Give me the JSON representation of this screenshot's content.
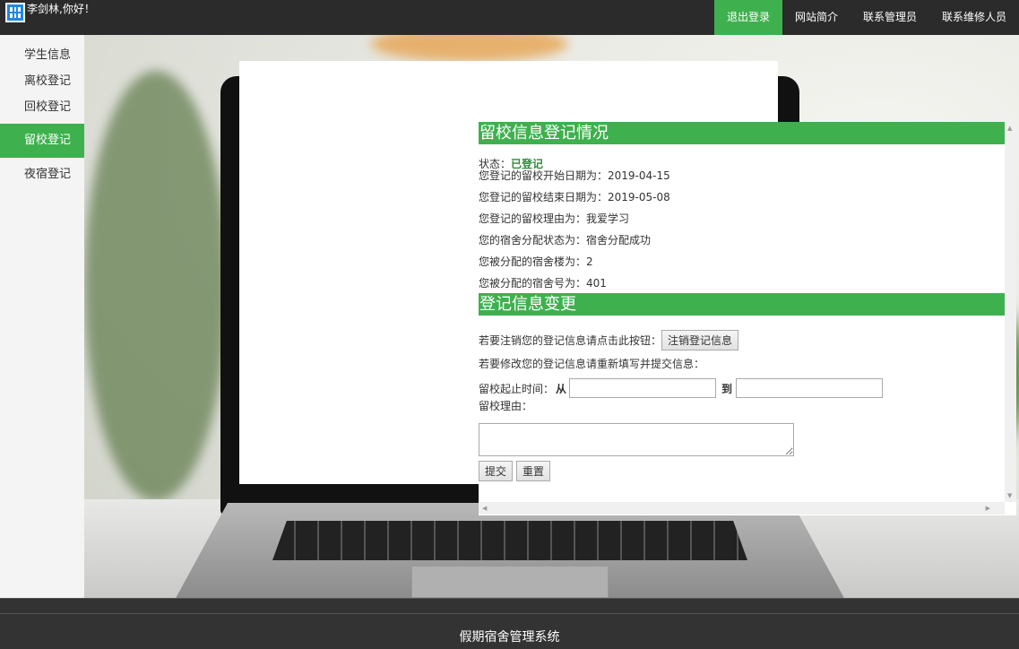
{
  "header": {
    "greeting": "李剑林,你好！",
    "nav": [
      "退出登录",
      "网站简介",
      "联系管理员",
      "联系维修人员"
    ]
  },
  "sidebar": {
    "items": [
      "学生信息",
      "离校登记",
      "回校登记",
      "留校登记",
      "夜宿登记"
    ],
    "active": "留校登记"
  },
  "panel": {
    "section1_title": "留校信息登记情况",
    "status_label": "状态：",
    "status_value": "已登记",
    "lines": [
      "您登记的留校开始日期为：2019-04-15",
      "您登记的留校结束日期为：2019-05-08",
      "您登记的留校理由为：我爱学习",
      "您的宿舍分配状态为：宿舍分配成功",
      "您被分配的宿舍楼为：2",
      "您被分配的宿舍号为：401"
    ],
    "section2_title": "登记信息变更",
    "cancel_prompt": "若要注销您的登记信息请点击此按钮：",
    "cancel_button": "注销登记信息",
    "modify_prompt": "若要修改您的登记信息请重新填写并提交信息：",
    "time_label": "留校起止时间：",
    "from_label": "从",
    "to_label": "到",
    "from_value": "",
    "to_value": "",
    "reason_label": "留校理由：",
    "reason_value": "",
    "submit_button": "提交",
    "reset_button": "重置"
  },
  "footer": {
    "text": "假期宿舍管理系统"
  },
  "colors": {
    "accent": "#3fb04e",
    "topbar": "#2b2b2b",
    "footer": "#333333"
  }
}
